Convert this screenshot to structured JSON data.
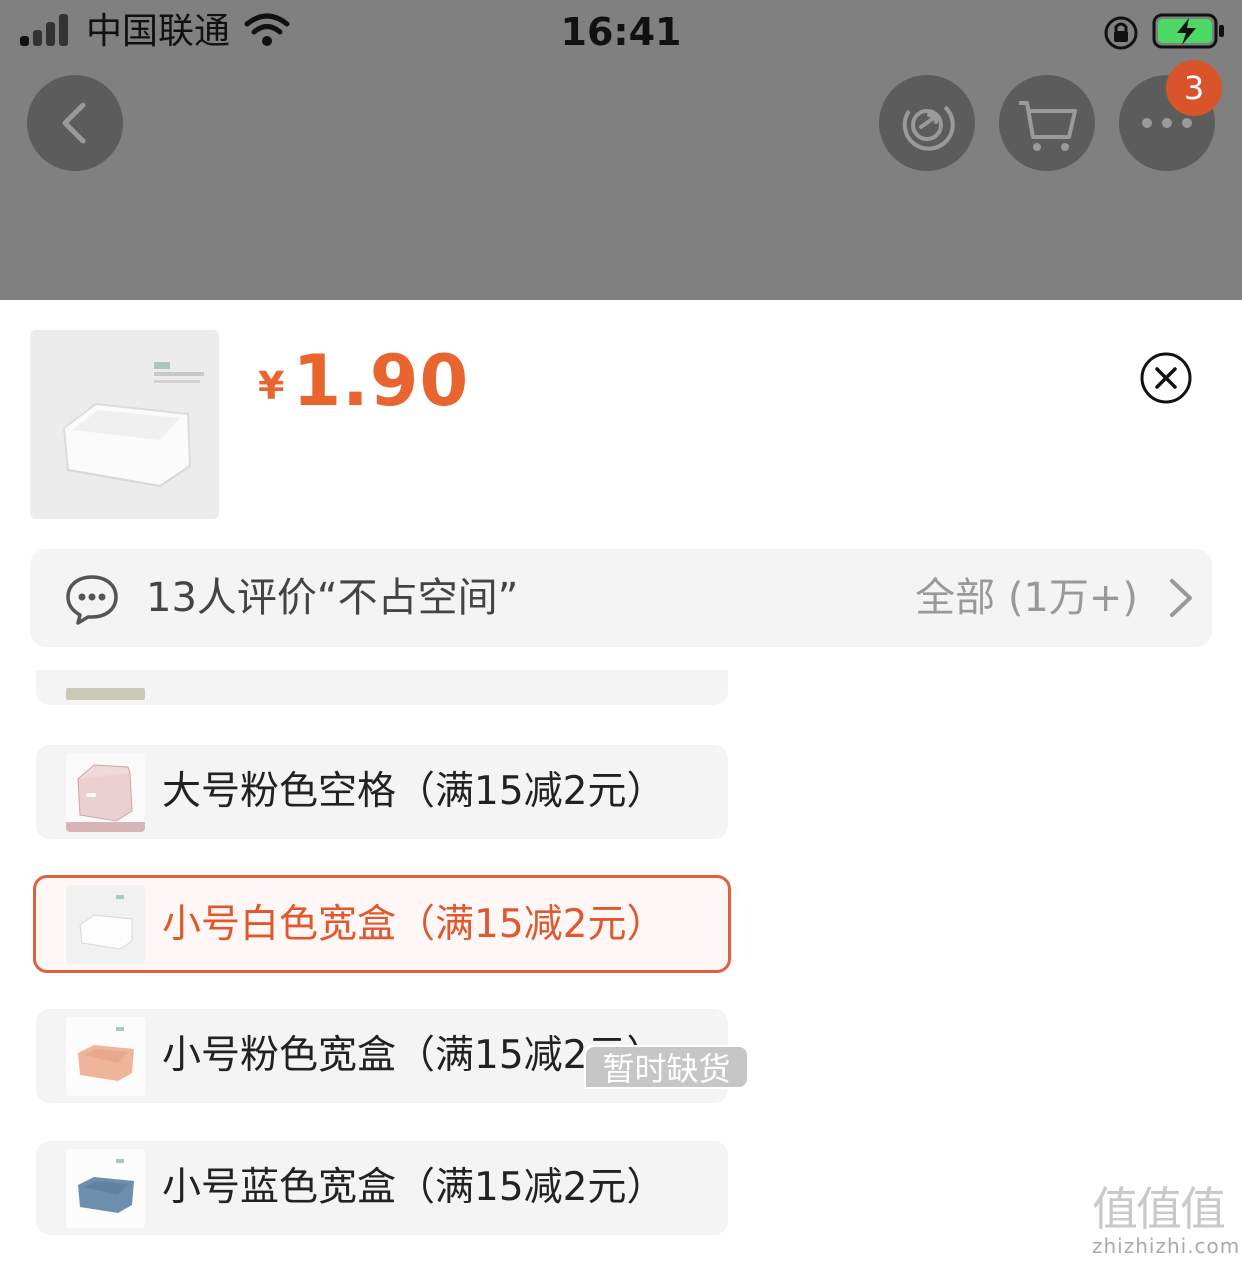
{
  "status_bar": {
    "carrier": "中国联通",
    "time": "16:41"
  },
  "header": {
    "cart_badge_count": "3",
    "icons": [
      "back-icon",
      "share-icon",
      "cart-icon",
      "more-icon"
    ]
  },
  "product": {
    "currency": "¥",
    "price": "1.90"
  },
  "review": {
    "summary": "13人评价“不占空间”",
    "all_label": "全部 (1万+)"
  },
  "options": [
    {
      "label": "大号粉色空格（满15减2元）",
      "selected": false,
      "color": "#e9c9c8"
    },
    {
      "label": "小号白色宽盒（满15减2元）",
      "selected": true,
      "color": "#ffffff"
    },
    {
      "label": "小号粉色宽盒（满15减2元）",
      "selected": false,
      "color": "#efb59a"
    },
    {
      "label": "小号蓝色宽盒（满15减2元）",
      "selected": false,
      "color": "#6d8fae"
    }
  ],
  "out_of_stock_label": "暂时缺货",
  "watermark": {
    "mark": "值值值",
    "site": "zhizhizhi.com"
  },
  "colors": {
    "accent": "#e8652f",
    "overlay": "#808080",
    "badge": "#d9532b"
  }
}
